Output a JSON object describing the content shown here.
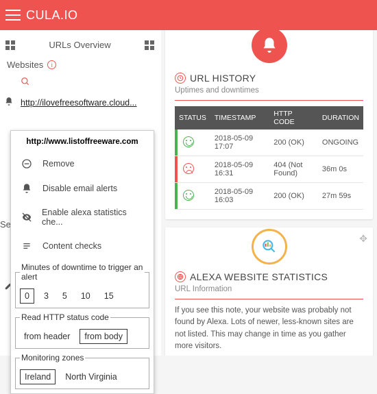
{
  "topbar": {
    "brand": "CULA.IO"
  },
  "sidebar": {
    "overview_label": "URLs Overview",
    "websites_label": "Websites",
    "url1": "http://ilovefreesoftware.cloud...",
    "truncated_services": "Serv"
  },
  "popup": {
    "title": "http://www.listoffreeware.com",
    "remove": "Remove",
    "disable_alerts": "Disable email alerts",
    "enable_alexa": "Enable alexa statistics che...",
    "content_checks": "Content checks",
    "downtime_legend": "Minutes of downtime to trigger an alert",
    "downtime_opts": [
      "0",
      "3",
      "5",
      "10",
      "15"
    ],
    "http_legend": "Read HTTP status code",
    "http_opts": [
      "from header",
      "from body"
    ],
    "zones_legend": "Monitoring zones",
    "zones_opts": [
      "Ireland",
      "North Virginia"
    ]
  },
  "history": {
    "title": "URL HISTORY",
    "subtitle": "Uptimes and downtimes",
    "cols": {
      "status": "STATUS",
      "timestamp": "TIMESTAMP",
      "http": "HTTP CODE",
      "duration": "DURATION"
    },
    "rows": [
      {
        "ok": true,
        "ts": "2018-05-09 17:07",
        "code": "200 (OK)",
        "dur": "ONGOING"
      },
      {
        "ok": false,
        "ts": "2018-05-09 16:31",
        "code": "404 (Not Found)",
        "dur": "36m 0s"
      },
      {
        "ok": true,
        "ts": "2018-05-09 16:03",
        "code": "200 (OK)",
        "dur": "27m 59s"
      }
    ]
  },
  "alexa": {
    "title": "ALEXA WEBSITE STATISTICS",
    "subtitle": "URL Information",
    "body": "If you see this note, your website was probably not found by Alexa. Lots of newer, less-known sites are not listed. This may change in time as you gather more visitors."
  }
}
